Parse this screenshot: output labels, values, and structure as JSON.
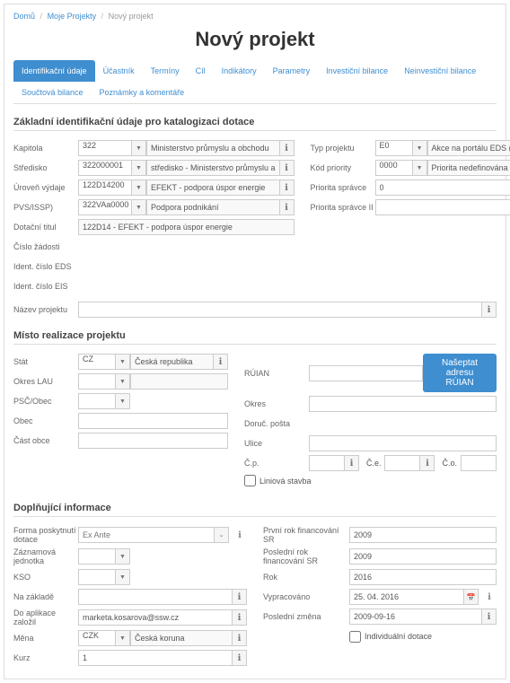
{
  "breadcrumb": {
    "home": "Domů",
    "projects": "Moje Projekty",
    "current": "Nový projekt"
  },
  "title": "Nový projekt",
  "tabs": {
    "t0": "Identifikační údaje",
    "t1": "Účastník",
    "t2": "Termíny",
    "t3": "Cíl",
    "t4": "Indikátory",
    "t5": "Parametry",
    "t6": "Investiční bilance",
    "t7": "Neinvestiční bilance",
    "t8": "Součtová bilance",
    "t9": "Poznámky a komentáře"
  },
  "sections": {
    "s1": "Základní identifikační údaje pro katalogizaci dotace",
    "s2": "Místo realizace projektu",
    "s3": "Doplňující informace"
  },
  "s1L": {
    "kapitola": {
      "label": "Kapitola",
      "code": "322",
      "text": "Ministerstvo průmyslu a obchodu"
    },
    "stredisko": {
      "label": "Středisko",
      "code": "322000001",
      "text": "středisko - Ministerstvo průmyslu a"
    },
    "uroven": {
      "label": "Úroveň výdaje",
      "code": "122D14200",
      "text": "EFEKT - podpora úspor energie"
    },
    "pvs": {
      "label": "PVS/ISSP)",
      "code": "322VAa0000",
      "text": "Podpora podnikání"
    },
    "dotacni": {
      "label": "Dotační titul",
      "text": "122D14 - EFEKT - podpora úspor energie"
    },
    "cisloZ": {
      "label": "Číslo žádosti"
    },
    "identEDS": {
      "label": "Ident. číslo EDS"
    },
    "identEIS": {
      "label": "Ident. číslo EIS"
    },
    "nazev": {
      "label": "Název projektu"
    }
  },
  "s1R": {
    "typ": {
      "label": "Typ projektu",
      "code": "E0",
      "text": "Akce na portálu EDS (seznam žád"
    },
    "kod": {
      "label": "Kód priority",
      "code": "0000",
      "text": "Priorita nedefinována"
    },
    "p1": {
      "label": "Priorita správce",
      "code": "0"
    },
    "p2": {
      "label": "Priorita správce II"
    }
  },
  "s2L": {
    "stat": {
      "label": "Stát",
      "code": "CZ",
      "text": "Česká republika"
    },
    "okresLau": {
      "label": "Okres LAU"
    },
    "psc": {
      "label": "PSČ/Obec"
    },
    "obec": {
      "label": "Obec"
    },
    "castObce": {
      "label": "Část obce"
    }
  },
  "s2R": {
    "ruian": {
      "label": "RÚIAN",
      "btn": "Našeptat adresu RÚIAN"
    },
    "okres": {
      "label": "Okres"
    },
    "doruc": {
      "label": "Doruč. pošta"
    },
    "ulice": {
      "label": "Ulice"
    },
    "cp": {
      "label": "Č.p."
    },
    "ce": {
      "label": "Č.e."
    },
    "co": {
      "label": "Č.o."
    },
    "liniova": "Liniová stavba"
  },
  "s3L": {
    "forma": {
      "label": "Forma poskytnutí dotace",
      "value": "Ex Ante"
    },
    "zaznamova": {
      "label": "Záznamová jednotka"
    },
    "kso": {
      "label": "KSO"
    },
    "nazaklade": {
      "label": "Na základě"
    },
    "doaplikace": {
      "label": "Do aplikace založil",
      "value": "marketa.kosarova@ssw.cz"
    },
    "mena": {
      "label": "Měna",
      "code": "CZK",
      "text": "Česká koruna"
    },
    "kurz": {
      "label": "Kurz",
      "value": "1"
    }
  },
  "s3R": {
    "prvni": {
      "label": "První rok financování SR",
      "value": "2009"
    },
    "posledni": {
      "label": "Poslední rok financování SR",
      "value": "2009"
    },
    "rok": {
      "label": "Rok",
      "value": "2016"
    },
    "vypracovano": {
      "label": "Vypracováno",
      "value": "25. 04. 2016"
    },
    "poslzmena": {
      "label": "Poslední změna",
      "value": "2009-09-16"
    },
    "individ": "Individuální dotace"
  }
}
